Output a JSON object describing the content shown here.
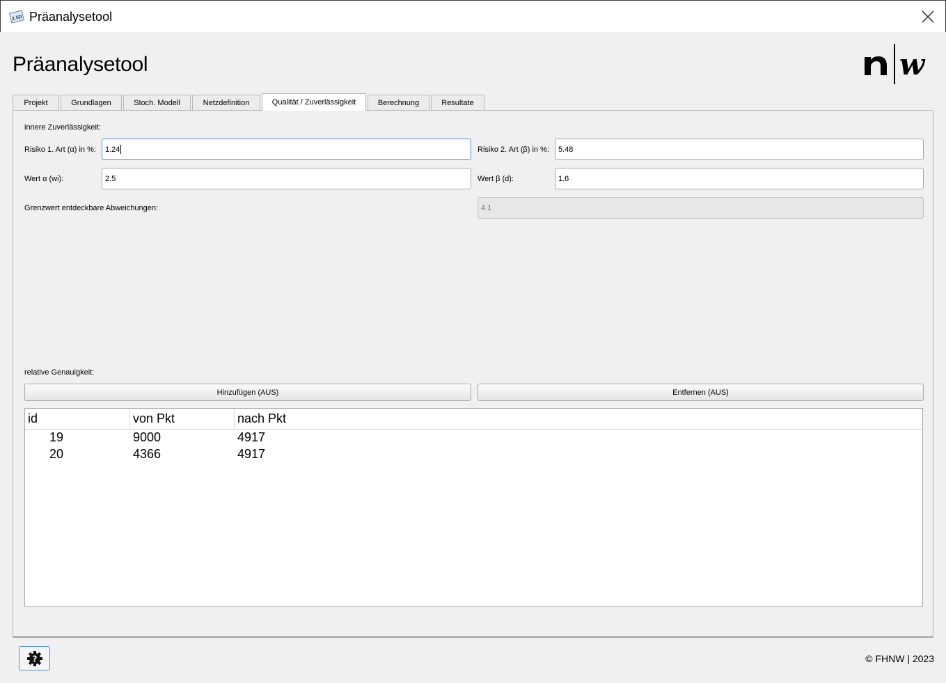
{
  "window": {
    "title": "Präanalysetool",
    "app_icon_text": "2.5D"
  },
  "page_title": "Präanalysetool",
  "tabs": [
    {
      "label": "Projekt"
    },
    {
      "label": "Grundlagen"
    },
    {
      "label": "Stoch. Modell"
    },
    {
      "label": "Netzdefinition"
    },
    {
      "label": "Qualität / Zuverlässigkeit",
      "active": true
    },
    {
      "label": "Berechnung"
    },
    {
      "label": "Resultate"
    }
  ],
  "reliability": {
    "section_label": "innere Zuverlässigkeit:",
    "risk1": {
      "label": "Risiko 1. Art (α) in %:",
      "value": "1.24"
    },
    "risk2": {
      "label": "Risiko 2. Art (β) in %:",
      "value": "5.48"
    },
    "alpha": {
      "label": "Wert α (wi):",
      "value": "2.5"
    },
    "beta": {
      "label": "Wert β (d):",
      "value": "1.6"
    },
    "limit": {
      "label": "Grenzwert entdeckbare Abweichungen:",
      "value": "4.1"
    }
  },
  "accuracy": {
    "section_label": "relative Genauigkeit:",
    "add_button": "Hinzufügen (AUS)",
    "remove_button": "Entfernen (AUS)",
    "columns": [
      "id",
      "von Pkt",
      "nach Pkt"
    ],
    "rows": [
      [
        "19",
        "9000",
        "4917"
      ],
      [
        "20",
        "4366",
        "4917"
      ]
    ]
  },
  "footer": {
    "copyright": "© FHNW | 2023"
  },
  "colors": {
    "focus_border": "#4a90d9",
    "panel_bg": "#f0f0f0"
  }
}
